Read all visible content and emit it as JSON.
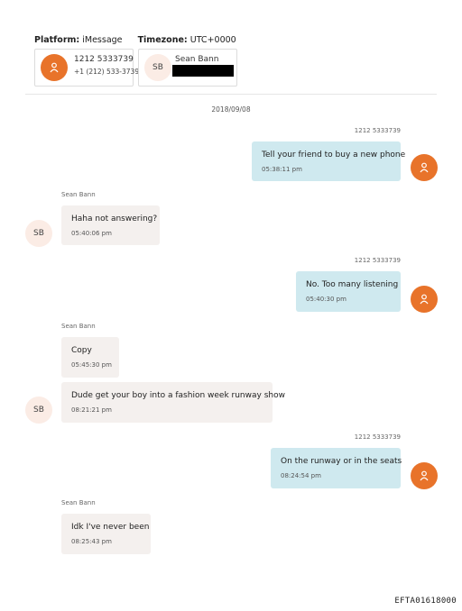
{
  "header": {
    "platform_label": "Platform:",
    "platform_value": "iMessage",
    "timezone_label": "Timezone:",
    "timezone_value": "UTC+0000"
  },
  "participants": [
    {
      "name": "1212 5333739",
      "number": "+1 (212) 533-3739",
      "avatar": "person-icon"
    },
    {
      "name": "Sean Bann",
      "initials": "SB",
      "number_redacted": true
    }
  ],
  "date": "2018/09/08",
  "messages": [
    {
      "direction": "outgoing",
      "sender": "1212 5333739",
      "text": "Tell your friend to buy a new phone",
      "time": "05:38:11 pm"
    },
    {
      "direction": "incoming",
      "sender": "Sean Bann",
      "text": "Haha not answering?",
      "time": "05:40:06 pm"
    },
    {
      "direction": "outgoing",
      "sender": "1212 5333739",
      "text": "No.  Too many listening",
      "time": "05:40:30 pm"
    },
    {
      "direction": "incoming",
      "sender": "Sean Bann",
      "text": "Copy",
      "time": "05:45:30 pm"
    },
    {
      "direction": "incoming",
      "sender": "",
      "text": "Dude get your boy into a fashion week runway show",
      "time": "08:21:21 pm"
    },
    {
      "direction": "outgoing",
      "sender": "1212 5333739",
      "text": "On the runway or in the seats",
      "time": "08:24:54 pm"
    },
    {
      "direction": "incoming",
      "sender": "Sean Bann",
      "text": "Idk I've never been",
      "time": "08:25:43 pm"
    }
  ],
  "footer": {
    "doc_id": "EFTA01618000"
  },
  "colors": {
    "outgoing_bubble": "#cfe9ef",
    "incoming_bubble": "#f4f0ee",
    "avatar_orange": "#e8732a",
    "avatar_sb_bg": "#fbece5"
  }
}
